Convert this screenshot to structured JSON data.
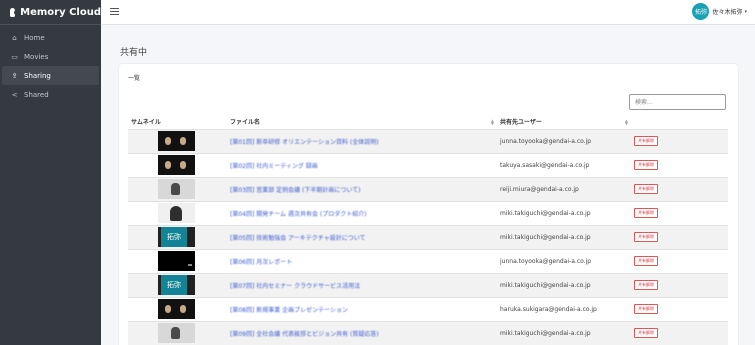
{
  "app": {
    "name": "Memory Cloud"
  },
  "sidebar": {
    "items": [
      {
        "label": "Home",
        "icon": "home-icon",
        "glyph": "⌂"
      },
      {
        "label": "Movies",
        "icon": "video-icon",
        "glyph": "▭"
      },
      {
        "label": "Sharing",
        "icon": "share-out-icon",
        "glyph": "⇪"
      },
      {
        "label": "Shared",
        "icon": "share-nodes-icon",
        "glyph": "<"
      }
    ]
  },
  "user": {
    "avatar_text": "拓弥",
    "name": "佐々木拓弥"
  },
  "page": {
    "title": "共有中"
  },
  "card": {
    "title": "一覧"
  },
  "search": {
    "placeholder": "検索..."
  },
  "table": {
    "headers": {
      "thumbnail": "サムネイル",
      "file_name": "ファイル名",
      "shared_user": "共有先ユーザー"
    },
    "unshare_label": "共有解除",
    "rows": [
      {
        "thumb": "dark",
        "file_name": "[第01回] 新卒研修 オリエンテーション資料 (全体説明)",
        "email": "junna.toyooka@gendai-a.co.jp"
      },
      {
        "thumb": "dark",
        "file_name": "[第02回] 社内ミーティング 録画",
        "email": "takuya.sasaki@gendai-a.co.jp"
      },
      {
        "thumb": "light",
        "file_name": "[第03回] 営業部 定例会議 (下半期計画について)",
        "email": "reiji.miura@gendai-a.co.jp"
      },
      {
        "thumb": "person",
        "file_name": "[第04回] 開発チーム 週次共有会 (プロダクト紹介)",
        "email": "miki.takiguchi@gendai-a.co.jp"
      },
      {
        "thumb": "teal",
        "file_name": "[第05回] 技術勉強会 アーキテクチャ設計について",
        "email": "miki.takiguchi@gendai-a.co.jp"
      },
      {
        "thumb": "black",
        "file_name": "[第06回] 月次レポート",
        "email": "junna.toyooka@gendai-a.co.jp"
      },
      {
        "thumb": "teal",
        "file_name": "[第07回] 社内セミナー クラウドサービス活用法",
        "email": "miki.takiguchi@gendai-a.co.jp"
      },
      {
        "thumb": "dark",
        "file_name": "[第08回] 新規事業 企画プレゼンテーション",
        "email": "haruka.sukigara@gendai-a.co.jp"
      },
      {
        "thumb": "light",
        "file_name": "[第09回] 全社会議 代表挨拶とビジョン共有 (質疑応答)",
        "email": "miki.takiguchi@gendai-a.co.jp"
      }
    ]
  }
}
